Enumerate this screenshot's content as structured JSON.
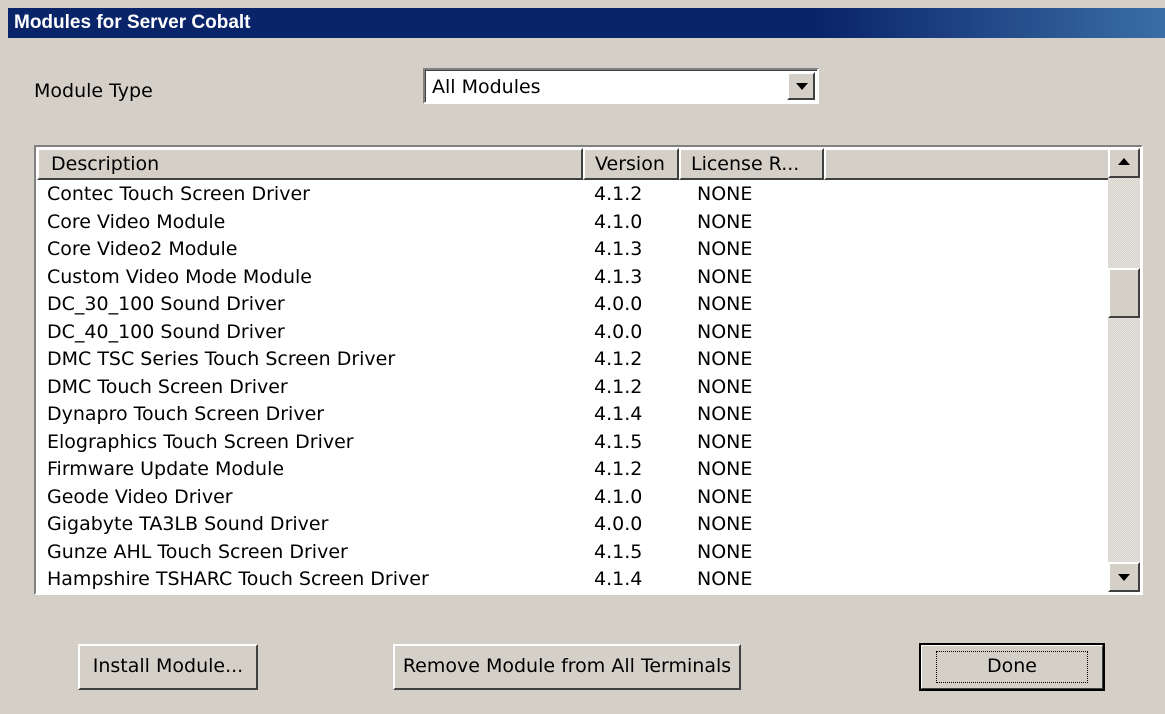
{
  "window": {
    "title": "Modules for Server Cobalt"
  },
  "filter": {
    "label": "Module Type",
    "selected": "All Modules"
  },
  "table": {
    "columns": [
      "Description",
      "Version",
      "License R..."
    ],
    "rows": [
      {
        "description": "Contec Touch Screen Driver",
        "version": "4.1.2",
        "license": "NONE"
      },
      {
        "description": "Core Video Module",
        "version": "4.1.0",
        "license": "NONE"
      },
      {
        "description": "Core Video2 Module",
        "version": "4.1.3",
        "license": "NONE"
      },
      {
        "description": "Custom Video Mode Module",
        "version": "4.1.3",
        "license": "NONE"
      },
      {
        "description": "DC_30_100 Sound Driver",
        "version": "4.0.0",
        "license": "NONE"
      },
      {
        "description": "DC_40_100 Sound Driver",
        "version": "4.0.0",
        "license": "NONE"
      },
      {
        "description": "DMC TSC Series Touch Screen Driver",
        "version": "4.1.2",
        "license": "NONE"
      },
      {
        "description": "DMC Touch Screen Driver",
        "version": "4.1.2",
        "license": "NONE"
      },
      {
        "description": "Dynapro Touch Screen Driver",
        "version": "4.1.4",
        "license": "NONE"
      },
      {
        "description": "Elographics Touch Screen Driver",
        "version": "4.1.5",
        "license": "NONE"
      },
      {
        "description": "Firmware Update Module",
        "version": "4.1.2",
        "license": "NONE"
      },
      {
        "description": "Geode Video Driver",
        "version": "4.1.0",
        "license": "NONE"
      },
      {
        "description": "Gigabyte TA3LB Sound Driver",
        "version": "4.0.0",
        "license": "NONE"
      },
      {
        "description": "Gunze AHL Touch Screen Driver",
        "version": "4.1.5",
        "license": "NONE"
      },
      {
        "description": "Hampshire TSHARC Touch Screen Driver",
        "version": "4.1.4",
        "license": "NONE"
      }
    ]
  },
  "buttons": {
    "install": "Install Module...",
    "remove": "Remove Module from All Terminals",
    "done": "Done"
  },
  "icons": {
    "dropdown": "chevron-down-icon",
    "scroll_up": "scroll-up-arrow-icon",
    "scroll_down": "scroll-down-arrow-icon"
  },
  "colors": {
    "titlebar": "#0a246a",
    "face": "#d4d0c8"
  }
}
